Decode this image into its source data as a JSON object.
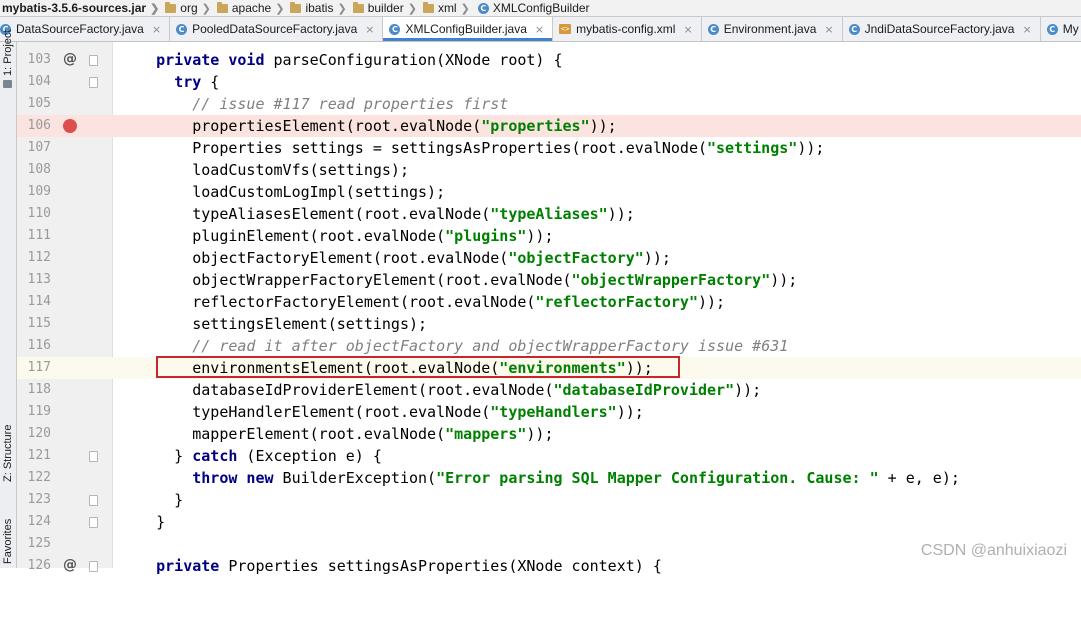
{
  "breadcrumb": [
    {
      "label": "mybatis-3.5.6-sources.jar",
      "kind": "jar"
    },
    {
      "label": "org",
      "kind": "folder"
    },
    {
      "label": "apache",
      "kind": "folder"
    },
    {
      "label": "ibatis",
      "kind": "folder"
    },
    {
      "label": "builder",
      "kind": "folder"
    },
    {
      "label": "xml",
      "kind": "folder"
    },
    {
      "label": "XMLConfigBuilder",
      "kind": "class"
    }
  ],
  "tabs": [
    {
      "label": "DataSourceFactory.java",
      "icon": "class",
      "active": false
    },
    {
      "label": "PooledDataSourceFactory.java",
      "icon": "class",
      "active": false
    },
    {
      "label": "XMLConfigBuilder.java",
      "icon": "class",
      "active": true
    },
    {
      "label": "mybatis-config.xml",
      "icon": "xml",
      "active": false
    },
    {
      "label": "Environment.java",
      "icon": "class",
      "active": false
    },
    {
      "label": "JndiDataSourceFactory.java",
      "icon": "class",
      "active": false
    },
    {
      "label": "My",
      "icon": "class",
      "active": false
    }
  ],
  "tool_strip": {
    "project": "1: Project",
    "structure": "Z: Structure",
    "favorites": "Favorites"
  },
  "class_icon_letter": "C",
  "xml_icon_text": "<>",
  "close_glyph": "×",
  "breakpoint_color": "#db4f4f",
  "highlight_box_color": "#c8262a",
  "watermark": "CSDN @anhuixiaozi",
  "code_lines": [
    {
      "n": "103",
      "mark": "override",
      "tokens": [
        [
          "",
          "    "
        ],
        [
          "kw",
          "private void"
        ],
        [
          "",
          " parseConfiguration(XNode root) {"
        ]
      ]
    },
    {
      "n": "104",
      "mark": "",
      "tokens": [
        [
          "",
          "      "
        ],
        [
          "kw",
          "try"
        ],
        [
          "",
          " {"
        ]
      ]
    },
    {
      "n": "105",
      "mark": "",
      "tokens": [
        [
          "",
          "        "
        ],
        [
          "cm",
          "// issue #117 read properties first"
        ]
      ]
    },
    {
      "n": "106",
      "mark": "breakpoint",
      "tokens": [
        [
          "",
          "        propertiesElement(root.evalNode("
        ],
        [
          "str",
          "\"properties\""
        ],
        [
          "",
          "));"
        ]
      ]
    },
    {
      "n": "107",
      "mark": "",
      "tokens": [
        [
          "",
          "        Properties settings = settingsAsProperties(root.evalNode("
        ],
        [
          "str",
          "\"settings\""
        ],
        [
          "",
          "));"
        ]
      ]
    },
    {
      "n": "108",
      "mark": "",
      "tokens": [
        [
          "",
          "        loadCustomVfs(settings);"
        ]
      ]
    },
    {
      "n": "109",
      "mark": "",
      "tokens": [
        [
          "",
          "        loadCustomLogImpl(settings);"
        ]
      ]
    },
    {
      "n": "110",
      "mark": "",
      "tokens": [
        [
          "",
          "        typeAliasesElement(root.evalNode("
        ],
        [
          "str",
          "\"typeAliases\""
        ],
        [
          "",
          "));"
        ]
      ]
    },
    {
      "n": "111",
      "mark": "",
      "tokens": [
        [
          "",
          "        pluginElement(root.evalNode("
        ],
        [
          "str",
          "\"plugins\""
        ],
        [
          "",
          "));"
        ]
      ]
    },
    {
      "n": "112",
      "mark": "",
      "tokens": [
        [
          "",
          "        objectFactoryElement(root.evalNode("
        ],
        [
          "str",
          "\"objectFactory\""
        ],
        [
          "",
          "));"
        ]
      ]
    },
    {
      "n": "113",
      "mark": "",
      "tokens": [
        [
          "",
          "        objectWrapperFactoryElement(root.evalNode("
        ],
        [
          "str",
          "\"objectWrapperFactory\""
        ],
        [
          "",
          "));"
        ]
      ]
    },
    {
      "n": "114",
      "mark": "",
      "tokens": [
        [
          "",
          "        reflectorFactoryElement(root.evalNode("
        ],
        [
          "str",
          "\"reflectorFactory\""
        ],
        [
          "",
          "));"
        ]
      ]
    },
    {
      "n": "115",
      "mark": "",
      "tokens": [
        [
          "",
          "        settingsElement(settings);"
        ]
      ]
    },
    {
      "n": "116",
      "mark": "",
      "tokens": [
        [
          "",
          "        "
        ],
        [
          "cm",
          "// read it after objectFactory and objectWrapperFactory issue #631"
        ]
      ]
    },
    {
      "n": "117",
      "mark": "current",
      "tokens": [
        [
          "",
          "        environmentsElement(root.evalNode("
        ],
        [
          "str",
          "\"environments\""
        ],
        [
          "",
          "));"
        ]
      ]
    },
    {
      "n": "118",
      "mark": "",
      "tokens": [
        [
          "",
          "        databaseIdProviderElement(root.evalNode("
        ],
        [
          "str",
          "\"databaseIdProvider\""
        ],
        [
          "",
          "));"
        ]
      ]
    },
    {
      "n": "119",
      "mark": "",
      "tokens": [
        [
          "",
          "        typeHandlerElement(root.evalNode("
        ],
        [
          "str",
          "\"typeHandlers\""
        ],
        [
          "",
          "));"
        ]
      ]
    },
    {
      "n": "120",
      "mark": "",
      "tokens": [
        [
          "",
          "        mapperElement(root.evalNode("
        ],
        [
          "str",
          "\"mappers\""
        ],
        [
          "",
          "));"
        ]
      ]
    },
    {
      "n": "121",
      "mark": "",
      "tokens": [
        [
          "",
          "      } "
        ],
        [
          "kw",
          "catch"
        ],
        [
          "",
          " (Exception e) {"
        ]
      ]
    },
    {
      "n": "122",
      "mark": "",
      "tokens": [
        [
          "",
          "        "
        ],
        [
          "kw",
          "throw new"
        ],
        [
          "",
          " BuilderException("
        ],
        [
          "str",
          "\"Error parsing SQL Mapper Configuration. Cause: \""
        ],
        [
          "",
          " + e, e);"
        ]
      ]
    },
    {
      "n": "123",
      "mark": "",
      "tokens": [
        [
          "",
          "      }"
        ]
      ]
    },
    {
      "n": "124",
      "mark": "",
      "tokens": [
        [
          "",
          "    }"
        ]
      ]
    },
    {
      "n": "125",
      "mark": "",
      "tokens": [
        [
          "",
          ""
        ]
      ]
    },
    {
      "n": "126",
      "mark": "override",
      "tokens": [
        [
          "",
          "    "
        ],
        [
          "kw",
          "private"
        ],
        [
          "",
          " Properties settingsAsProperties(XNode context) {"
        ]
      ]
    }
  ]
}
